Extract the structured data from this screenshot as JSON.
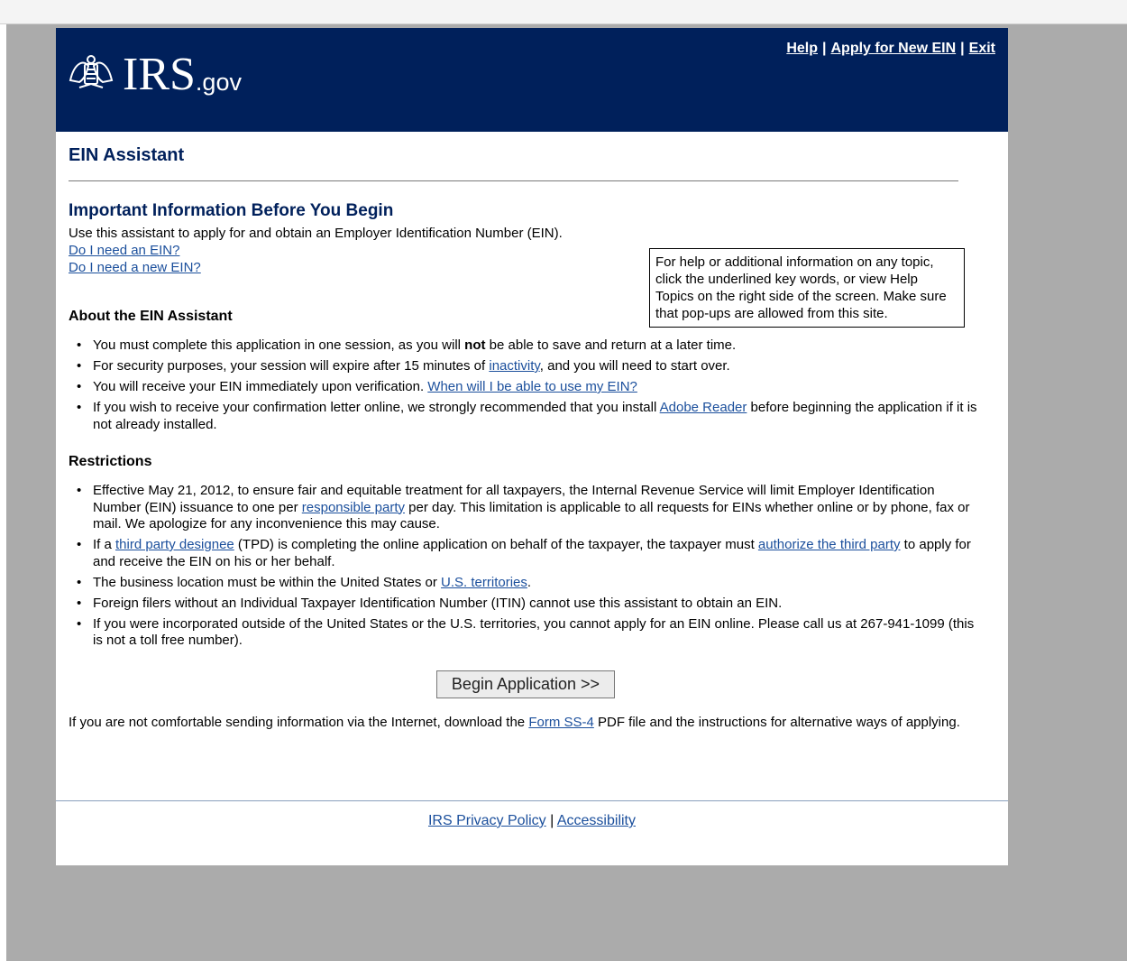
{
  "header": {
    "logo_text": "IRS",
    "logo_suffix": ".gov",
    "links": [
      "Help",
      "Apply for New EIN",
      "Exit"
    ],
    "separator": "|"
  },
  "page_title": "EIN Assistant",
  "important": {
    "heading": "Important Information Before You Begin",
    "intro": "Use this assistant to apply for and obtain an Employer Identification Number (EIN).",
    "link1": "Do I need an EIN?",
    "link2": "Do I need a new EIN?"
  },
  "helpbox": {
    "text": "For help or additional information on any topic, click the underlined key words, or view Help Topics on the right side of the screen. Make sure that pop-ups are allowed from this site."
  },
  "about": {
    "heading": "About the EIN Assistant",
    "b1_pre": "You must complete this application in one session, as you will ",
    "b1_bold": "not",
    "b1_post": " be able to save and return at a later time.",
    "b2_pre": "For security purposes, your session will expire after 15 minutes of ",
    "b2_link": "inactivity",
    "b2_post": ", and you will need to start over.",
    "b3_pre": "You will receive your EIN immediately upon verification. ",
    "b3_link": "When will I be able to use my EIN?",
    "b4_pre": "If you wish to receive your confirmation letter online, we strongly recommended that you install ",
    "b4_link": "Adobe Reader",
    "b4_post": " before beginning the application if it is not already installed."
  },
  "restrictions": {
    "heading": "Restrictions",
    "r1_pre": "Effective May 21, 2012, to ensure fair and equitable treatment for all taxpayers, the Internal Revenue Service will limit Employer Identification Number (EIN) issuance to one per ",
    "r1_link": "responsible party",
    "r1_post": " per day. This limitation is applicable to all requests for EINs whether online or by phone, fax or mail.  We apologize for any inconvenience this may cause.",
    "r2_pre": "If a ",
    "r2_link1": "third party designee",
    "r2_mid": " (TPD) is completing the online application on behalf of the taxpayer, the taxpayer must ",
    "r2_link2": "authorize the third party",
    "r2_post": " to apply for and receive the EIN on his or her behalf.",
    "r3_pre": "The business location must be within the United States or ",
    "r3_link": "U.S. territories",
    "r3_post": ".",
    "r4": "Foreign filers without an Individual Taxpayer Identification Number (ITIN) cannot use this assistant to obtain an EIN.",
    "r5": "If you were incorporated outside of the United States or the U.S. territories, you cannot apply for an EIN online. Please call us at 267-941-1099 (this is not a toll free number)."
  },
  "begin_button": "Begin Application >>",
  "alt": {
    "pre": "If you are not comfortable sending information via the Internet, download the ",
    "link": "Form SS-4",
    "post": " PDF file and the instructions for alternative ways of applying."
  },
  "footer": {
    "privacy": "IRS Privacy Policy",
    "sep": "|",
    "accessibility": "Accessibility"
  },
  "colors": {
    "header_bg": "#00205b",
    "title_color": "#00205b",
    "link_color": "#1b4f9c",
    "outer_bg": "#ababab"
  }
}
